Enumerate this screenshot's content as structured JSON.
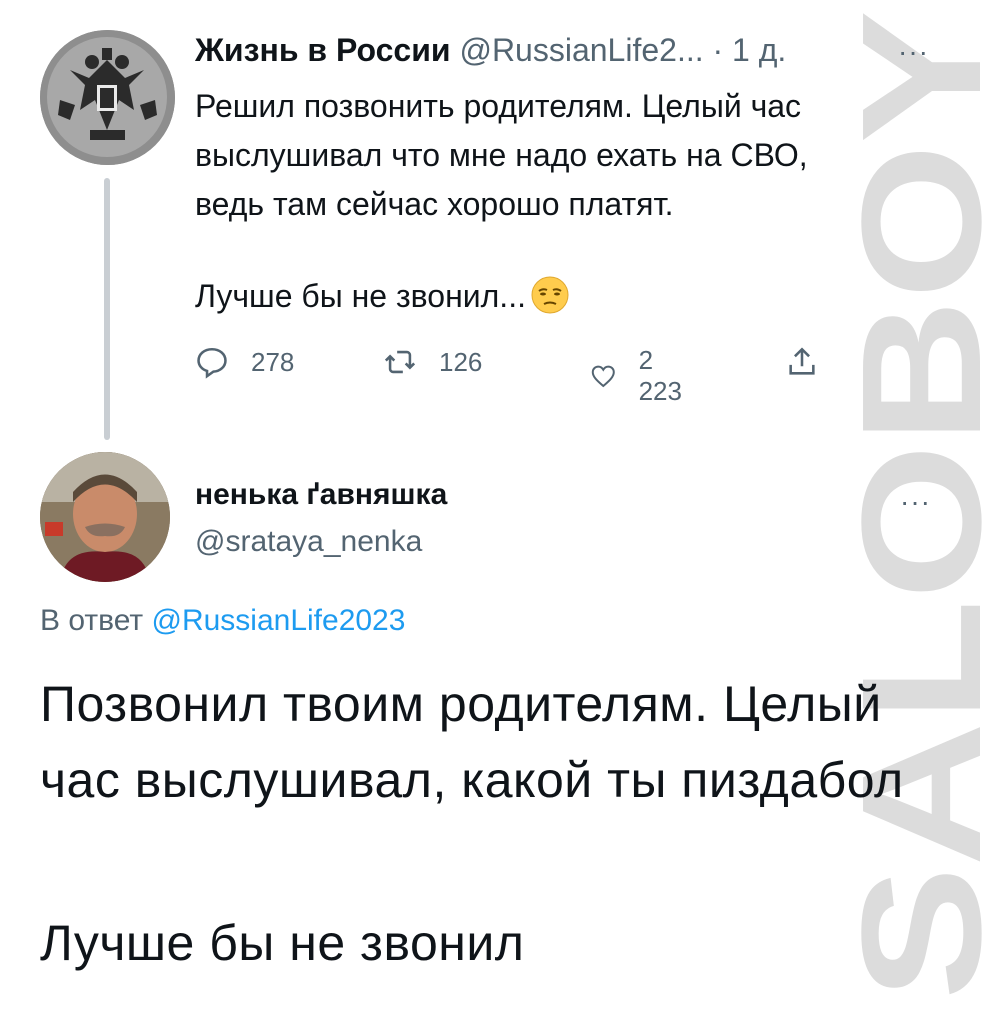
{
  "tweet": {
    "author_name": "Жизнь в России",
    "author_handle": "@RussianLife2...",
    "separator": "·",
    "time": "1 д.",
    "more": "···",
    "text_main": "Решил позвонить родителям. Целый час выслушивал что мне надо ехать на СВО, ведь там сейчас хорошо платят.",
    "text_tail": "Лучше бы не звонил...",
    "emoji": "unamused-face-icon",
    "replies": "278",
    "retweets": "126",
    "likes": "2 223"
  },
  "reply": {
    "author_name": "ненька ґавняшка",
    "author_handle": "@srataya_nenka",
    "more": "···",
    "reply_prefix": "В ответ",
    "reply_mention": "@RussianLife2023",
    "text_main": "Позвонил твоим родителям. Целый час выслушивал, какой ты пиздабол",
    "text_tail": "Лучше бы не звонил"
  },
  "watermark": "SALOBOY",
  "colors": {
    "text": "#0f1419",
    "secondary": "#536471",
    "link": "#1d9bf0",
    "thread_line": "#c9ced3",
    "watermark": "#d9d9d9"
  }
}
